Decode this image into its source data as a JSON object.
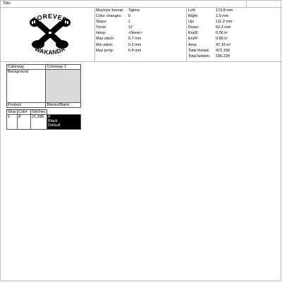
{
  "title_label": "Title:",
  "logo": {
    "text": "WAKANDA FOREVER",
    "icon": "crossed-arms-emblem"
  },
  "machine": [
    {
      "label": "Machine format:",
      "value": "Tajima"
    },
    {
      "label": "Color changes:",
      "value": "0"
    },
    {
      "label": "Stops:",
      "value": "1"
    },
    {
      "label": "Trims:",
      "value": "12"
    },
    {
      "label": "Hoop:",
      "value": "<None>"
    },
    {
      "label": "Max stitch:",
      "value": "6.7 mm"
    },
    {
      "label": "Min stitch:",
      "value": "0.2 mm"
    },
    {
      "label": "Max jump:",
      "value": "6.4 mm"
    }
  ],
  "extent": [
    {
      "label": "Left:",
      "value": "173.8 mm"
    },
    {
      "label": "Right:",
      "value": "1.5 mm"
    },
    {
      "label": "Up:",
      "value": "111.2 mm"
    },
    {
      "label": "Down:",
      "value": "62.3 mm"
    },
    {
      "label": "EndX:",
      "value": "0.06 in"
    },
    {
      "label": "EndY:",
      "value": "0.89 in"
    },
    {
      "label": "Area",
      "value": "47.15 in²"
    },
    {
      "label": "Total thread:",
      "value": "471.15ft"
    },
    {
      "label": "Total bobbin:",
      "value": "196.22ft"
    }
  ],
  "colorway_table": {
    "header_label": "Colorway",
    "header_value": "Colorway 1",
    "background_label": "Background",
    "product_label": "Product",
    "product_value": "Blanks/Blank",
    "columns": [
      "Stop",
      "Color",
      "Stitches"
    ],
    "row": {
      "stop": "1",
      "color": "8",
      "stitches": "21,288",
      "thread_code": "8",
      "thread_name": "Black",
      "thread_brand": "Default",
      "thread_color": "#000000"
    },
    "background_color": "#d9d9d9"
  }
}
